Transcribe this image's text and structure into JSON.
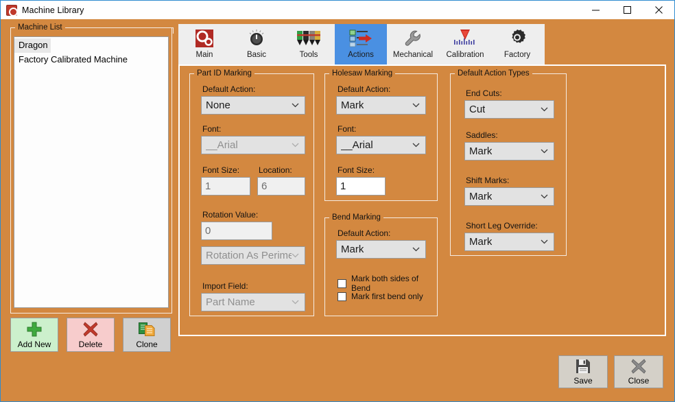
{
  "window": {
    "title": "Machine Library",
    "icon": "app-icon",
    "minimize_label": "—",
    "maximize_label": "□",
    "close_label": "✕",
    "accent_border": "#2e8bd0",
    "body_background": "#d38840"
  },
  "machine_list": {
    "group_label": "Machine List",
    "items": [
      {
        "label": "Dragon",
        "selected": true
      },
      {
        "label": "Factory Calibrated Machine",
        "selected": false
      }
    ]
  },
  "list_buttons": [
    {
      "label": "Add New",
      "icon": "plus-icon",
      "background": "#ccf0cc"
    },
    {
      "label": "Delete",
      "icon": "x-mark-icon",
      "background": "#f7cccc"
    },
    {
      "label": "Clone",
      "icon": "copy-icon",
      "background": "#d0d0d0"
    }
  ],
  "tabs": [
    {
      "label": "Main",
      "icon": "gears-icon",
      "active": false
    },
    {
      "label": "Basic",
      "icon": "dial-knob-icon",
      "active": false
    },
    {
      "label": "Tools",
      "icon": "markers-icon",
      "active": false
    },
    {
      "label": "Actions",
      "icon": "actions-arrow-icon",
      "active": true
    },
    {
      "label": "Mechanical",
      "icon": "wrench-icon",
      "active": false
    },
    {
      "label": "Calibration",
      "icon": "calibration-gauge-icon",
      "active": false
    },
    {
      "label": "Factory",
      "icon": "gear-icon",
      "active": false
    }
  ],
  "part_id_marking": {
    "group_label": "Part ID Marking",
    "default_action": {
      "label": "Default Action:",
      "value": "None",
      "enabled": true
    },
    "font": {
      "label": "Font:",
      "value": "__Arial",
      "enabled": false
    },
    "font_size": {
      "label": "Font Size:",
      "value": "1",
      "enabled": false
    },
    "location": {
      "label": "Location:",
      "value": "6",
      "enabled": false
    },
    "rotation_value": {
      "label": "Rotation Value:",
      "value": "0",
      "enabled": false
    },
    "rotation_mode": {
      "value": "Rotation As Perimeter",
      "enabled": false
    },
    "import_field": {
      "label": "Import Field:",
      "value": "Part Name",
      "enabled": false
    }
  },
  "holesaw_marking": {
    "group_label": "Holesaw Marking",
    "default_action": {
      "label": "Default Action:",
      "value": "Mark",
      "enabled": true
    },
    "font": {
      "label": "Font:",
      "value": "__Arial",
      "enabled": true
    },
    "font_size": {
      "label": "Font Size:",
      "value": "1",
      "enabled": true
    }
  },
  "bend_marking": {
    "group_label": "Bend Marking",
    "default_action": {
      "label": "Default Action:",
      "value": "Mark",
      "enabled": true
    },
    "checkboxes": [
      {
        "label": "Mark both sides of Bend",
        "checked": false
      },
      {
        "label": "Mark first bend only",
        "checked": false
      }
    ]
  },
  "default_action_types": {
    "group_label": "Default Action Types",
    "fields": [
      {
        "label": "End Cuts:",
        "value": "Cut"
      },
      {
        "label": "Saddles:",
        "value": "Mark"
      },
      {
        "label": "Shift Marks:",
        "value": "Mark"
      },
      {
        "label": "Short Leg Override:",
        "value": "Mark"
      }
    ]
  },
  "footer_buttons": [
    {
      "label": "Save",
      "icon": "floppy-disk-icon"
    },
    {
      "label": "Close",
      "icon": "x-mark-icon"
    }
  ]
}
